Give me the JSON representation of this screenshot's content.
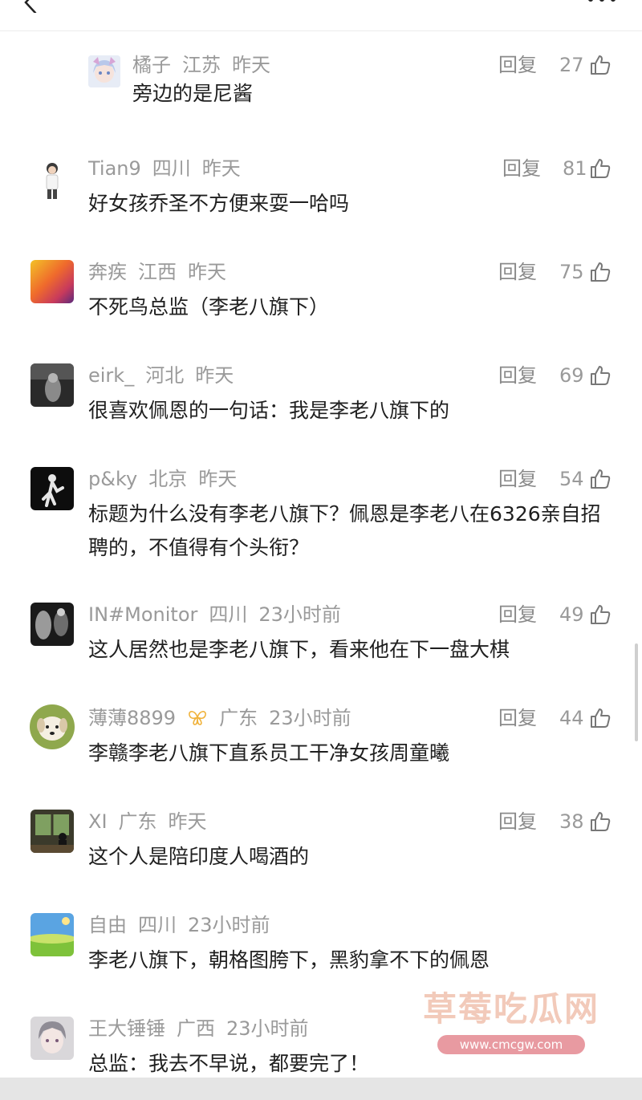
{
  "comments": [
    {
      "name": "橘子",
      "region": "江苏",
      "time": "昨天",
      "reply": "回复",
      "likes": "27",
      "text": "旁边的是尼酱",
      "avatar": "anime-girl-avatar"
    },
    {
      "name": "Tian9",
      "region": "四川",
      "time": "昨天",
      "reply": "回复",
      "likes": "81",
      "text": "好女孩乔圣不方便来耍一哈吗",
      "avatar": "cartoon-boy-avatar"
    },
    {
      "name": "奔疾",
      "region": "江西",
      "time": "昨天",
      "reply": "回复",
      "likes": "75",
      "text": "不死鸟总监（李老八旗下）",
      "avatar": "gradient-avatar"
    },
    {
      "name": "eirk_",
      "region": "河北",
      "time": "昨天",
      "reply": "回复",
      "likes": "69",
      "text": "很喜欢佩恩的一句话：我是李老八旗下的",
      "avatar": "dark-photo-avatar"
    },
    {
      "name": "p&ky",
      "region": "北京",
      "time": "昨天",
      "reply": "回复",
      "likes": "54",
      "text": "标题为什么没有李老八旗下？佩恩是李老八在6326亲自招聘的，不值得有个头衔？",
      "avatar": "dancer-avatar"
    },
    {
      "name": "IN#Monitor",
      "region": "四川",
      "time": "23小时前",
      "reply": "回复",
      "likes": "49",
      "text": "这人居然也是李老八旗下，看来他在下一盘大棋",
      "avatar": "monochrome-avatar"
    },
    {
      "name": "薄薄8899",
      "region": "广东",
      "time": "23小时前",
      "reply": "回复",
      "likes": "44",
      "text": "李赣李老八旗下直系员工干净女孩周童曦",
      "avatar": "puppy-avatar"
    },
    {
      "name": "XI",
      "region": "广东",
      "time": "昨天",
      "reply": "回复",
      "likes": "38",
      "text": "这个人是陪印度人喝酒的",
      "avatar": "window-scene-avatar"
    },
    {
      "name": "自由",
      "region": "四川",
      "time": "23小时前",
      "reply": "",
      "likes": "",
      "text": "李老八旗下，朝格图胯下，黑豹拿不下的佩恩",
      "avatar": "landscape-avatar"
    },
    {
      "name": "王大锤锤",
      "region": "广西",
      "time": "23小时前",
      "reply": "",
      "likes": "",
      "text": "总监：我去不早说，都要完了！",
      "avatar": "anime-boy-avatar"
    }
  ],
  "watermark": {
    "title": "草莓吃瓜网",
    "url": "www.cmcgw.com"
  },
  "colors": {
    "meta": "#9a9a9a",
    "text": "#1f1f1f",
    "watermark": "#e89e82"
  }
}
